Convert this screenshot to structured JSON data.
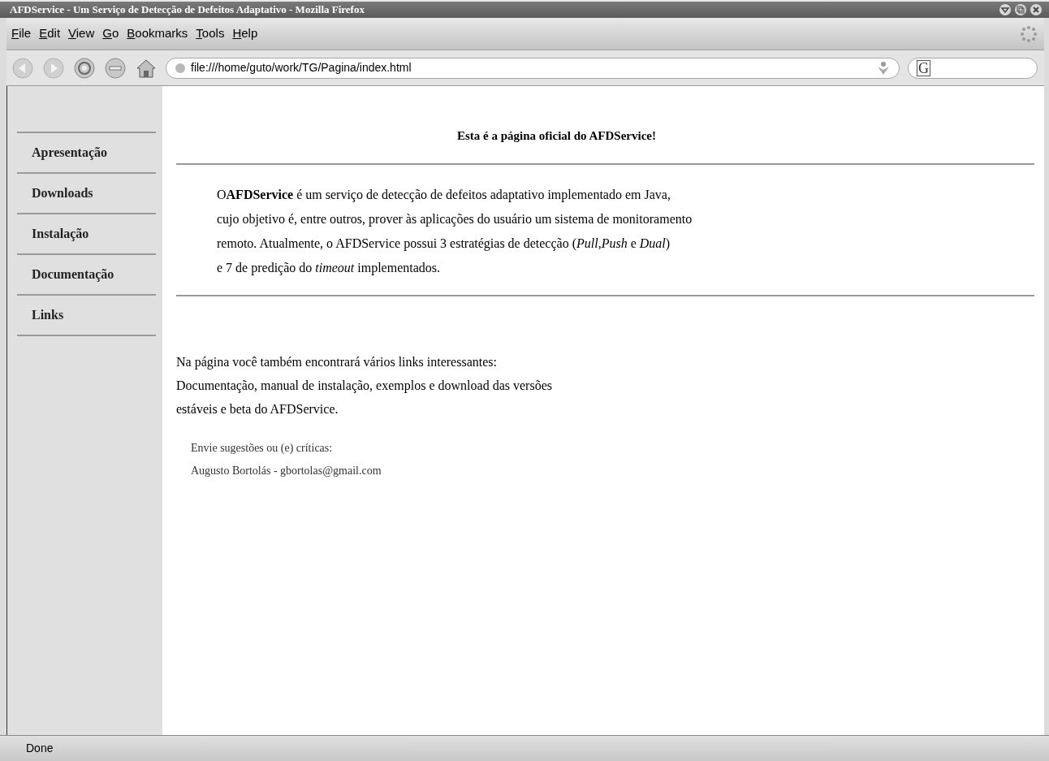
{
  "window": {
    "title": "AFDService - Um Serviço de Detecção de Defeitos Adaptativo - Mozilla Firefox"
  },
  "menu": [
    "File",
    "Edit",
    "View",
    "Go",
    "Bookmarks",
    "Tools",
    "Help"
  ],
  "address_bar": {
    "value": "file:///home/guto/work/TG/Pagina/index.html"
  },
  "search_box": {
    "engine_letter": "G"
  },
  "sidebar": {
    "items": [
      "Apresentação",
      "Downloads",
      "Instalação",
      "Documentação",
      "Links"
    ]
  },
  "page": {
    "heading": "Esta é a página oficial do AFDService!",
    "intro_lines": [
      "O**AFDService** é um serviço de detecção de defeitos adaptativo implementado em Java,",
      "cujo objetivo é, entre outros, prover às aplicações do usuário um sistema de monitoramento",
      "remoto. Atualmente, o AFDService possui 3 estratégias de detecção (*Pull*,*Push* e *Dual*)",
      "e 7 de predição do *timeout* implementados."
    ],
    "info_lines": [
      "Na página você também encontrará vários links interessantes:",
      "Documentação, manual de instalação, exemplos e download das versões",
      "estáveis e beta do AFDService."
    ],
    "contact_lines": [
      "Envie sugestões ou (e) críticas:",
      "Augusto Bortolás - gbortolas@gmail.com"
    ]
  },
  "status_bar": {
    "text": "Done"
  }
}
